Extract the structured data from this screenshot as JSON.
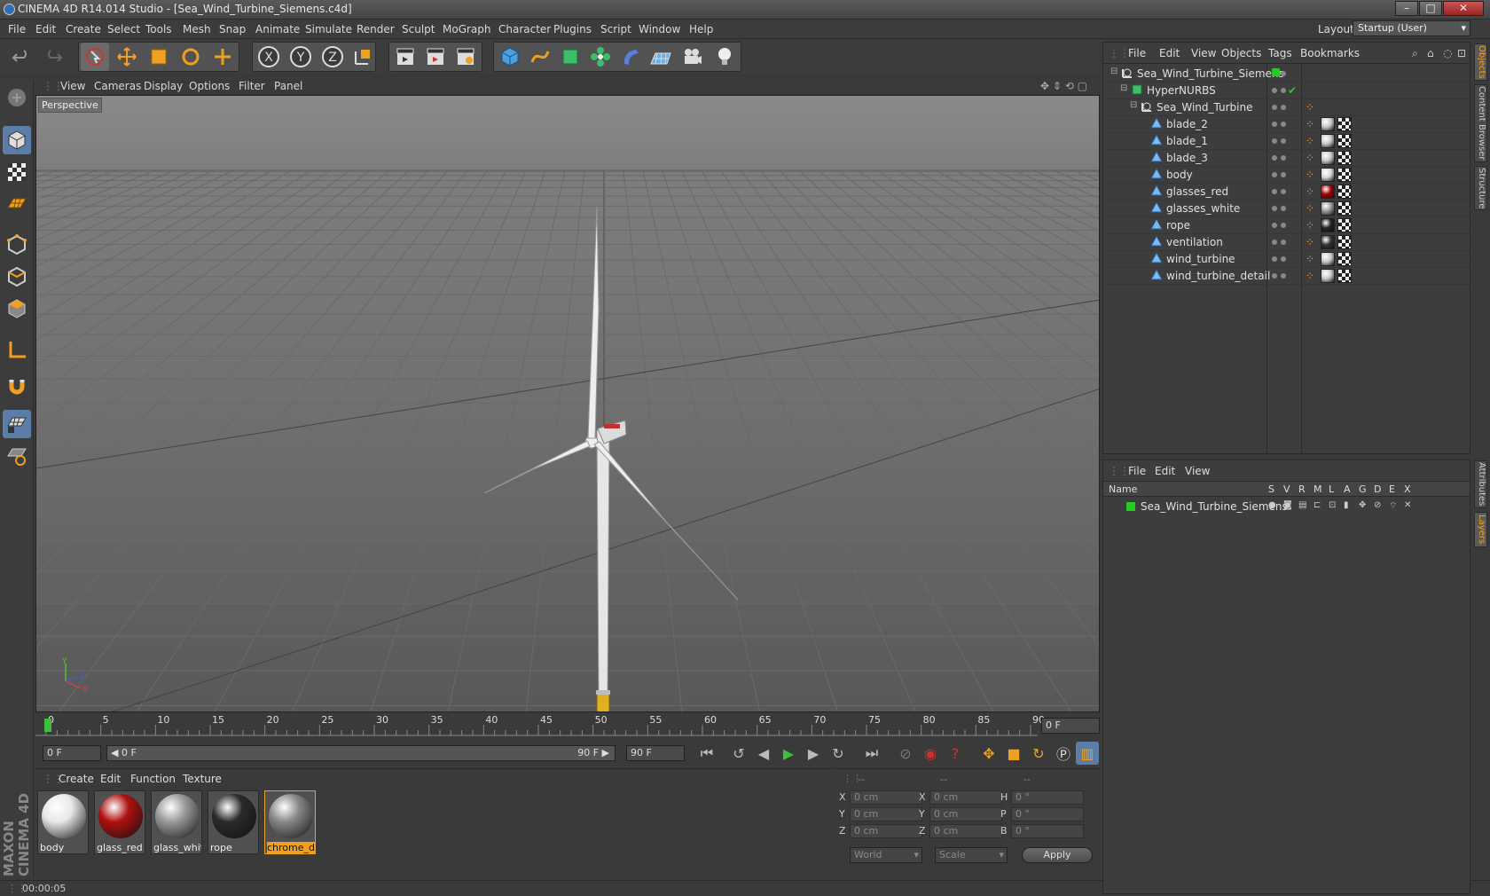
{
  "window": {
    "title": "CINEMA 4D R14.014 Studio - [Sea_Wind_Turbine_Siemens.c4d]",
    "buttons": [
      "–",
      "□",
      "✕"
    ]
  },
  "menubar": {
    "items": [
      "File",
      "Edit",
      "Create",
      "Select",
      "Tools",
      "Mesh",
      "Snap",
      "Animate",
      "Simulate",
      "Render",
      "Sculpt",
      "MoGraph",
      "Character",
      "Plugins",
      "Script",
      "Window",
      "Help"
    ],
    "layout_label": "Layout:",
    "layout_value": "Startup (User)"
  },
  "viewport": {
    "menu": [
      "View",
      "Cameras",
      "Display",
      "Options",
      "Filter",
      "Panel"
    ],
    "label": "Perspective",
    "axis_labels": [
      "Y",
      "Z",
      "X"
    ]
  },
  "timeline": {
    "ticks": [
      "0",
      "5",
      "10",
      "15",
      "20",
      "25",
      "30",
      "35",
      "40",
      "45",
      "50",
      "55",
      "60",
      "65",
      "70",
      "75",
      "80",
      "85",
      "90"
    ],
    "current_frame": "0 F",
    "start_field": "0 F",
    "range_start": "◀ 0 F",
    "range_end": "90 F ▶",
    "end_field": "90 F"
  },
  "materials": {
    "menu": [
      "Create",
      "Edit",
      "Function",
      "Texture"
    ],
    "items": [
      {
        "name": "body",
        "color": "#e8e8e8"
      },
      {
        "name": "glass_red",
        "color": "#b01010"
      },
      {
        "name": "glass_white",
        "color": "#9a9a9a"
      },
      {
        "name": "rope",
        "color": "#2a2a2a"
      },
      {
        "name": "chrome_de",
        "color": "#888888"
      }
    ]
  },
  "coords": {
    "headers": [
      "--",
      "--",
      "--"
    ],
    "rows": [
      {
        "a": "X",
        "av": "0 cm",
        "b": "X",
        "bv": "0 cm",
        "c": "H",
        "cv": "0 °"
      },
      {
        "a": "Y",
        "av": "0 cm",
        "b": "Y",
        "bv": "0 cm",
        "c": "P",
        "cv": "0 °"
      },
      {
        "a": "Z",
        "av": "0 cm",
        "b": "Z",
        "bv": "0 cm",
        "c": "B",
        "cv": "0 °"
      }
    ],
    "world": "World",
    "scale": "Scale",
    "apply": "Apply"
  },
  "status": {
    "time": "00:00:05"
  },
  "objects": {
    "menu": [
      "File",
      "Edit",
      "View",
      "Objects",
      "Tags",
      "Bookmarks"
    ],
    "items": [
      {
        "name": "Sea_Wind_Turbine_Siemens",
        "indent": 0,
        "type": "null"
      },
      {
        "name": "HyperNURBS",
        "indent": 1,
        "type": "nurbs"
      },
      {
        "name": "Sea_Wind_Turbine",
        "indent": 2,
        "type": "null"
      },
      {
        "name": "blade_2",
        "indent": 3,
        "type": "poly",
        "tag": "#c8c8c8"
      },
      {
        "name": "blade_1",
        "indent": 3,
        "type": "poly",
        "tag": "#c8c8c8"
      },
      {
        "name": "blade_3",
        "indent": 3,
        "type": "poly",
        "tag": "#c8c8c8"
      },
      {
        "name": "body",
        "indent": 3,
        "type": "poly",
        "tag": "#d8d8d8"
      },
      {
        "name": "glasses_red",
        "indent": 3,
        "type": "poly",
        "tag": "#a00000"
      },
      {
        "name": "glasses_white",
        "indent": 3,
        "type": "poly",
        "tag": "#9a9a9a"
      },
      {
        "name": "rope",
        "indent": 3,
        "type": "poly",
        "tag": "#222222"
      },
      {
        "name": "ventilation",
        "indent": 3,
        "type": "poly",
        "tag": "#333333"
      },
      {
        "name": "wind_turbine",
        "indent": 3,
        "type": "poly",
        "tag": "#c8c8c8"
      },
      {
        "name": "wind_turbine_detail",
        "indent": 3,
        "type": "poly",
        "tag": "#c8c8c8"
      }
    ]
  },
  "layers": {
    "menu": [
      "File",
      "Edit",
      "View"
    ],
    "columns": [
      "Name",
      "S",
      "V",
      "R",
      "M",
      "L",
      "A",
      "G",
      "D",
      "E",
      "X"
    ],
    "items": [
      {
        "name": "Sea_Wind_Turbine_Siemens",
        "color": "#22cc22"
      }
    ]
  },
  "sidetabs": [
    "Objects",
    "Content Browser",
    "Structure",
    "Attributes",
    "Layers"
  ],
  "brand": "MAXON CINEMA 4D",
  "colors": {
    "accent": "#f0a020",
    "selection": "#2f6fb3",
    "layer_green": "#22cc22"
  }
}
